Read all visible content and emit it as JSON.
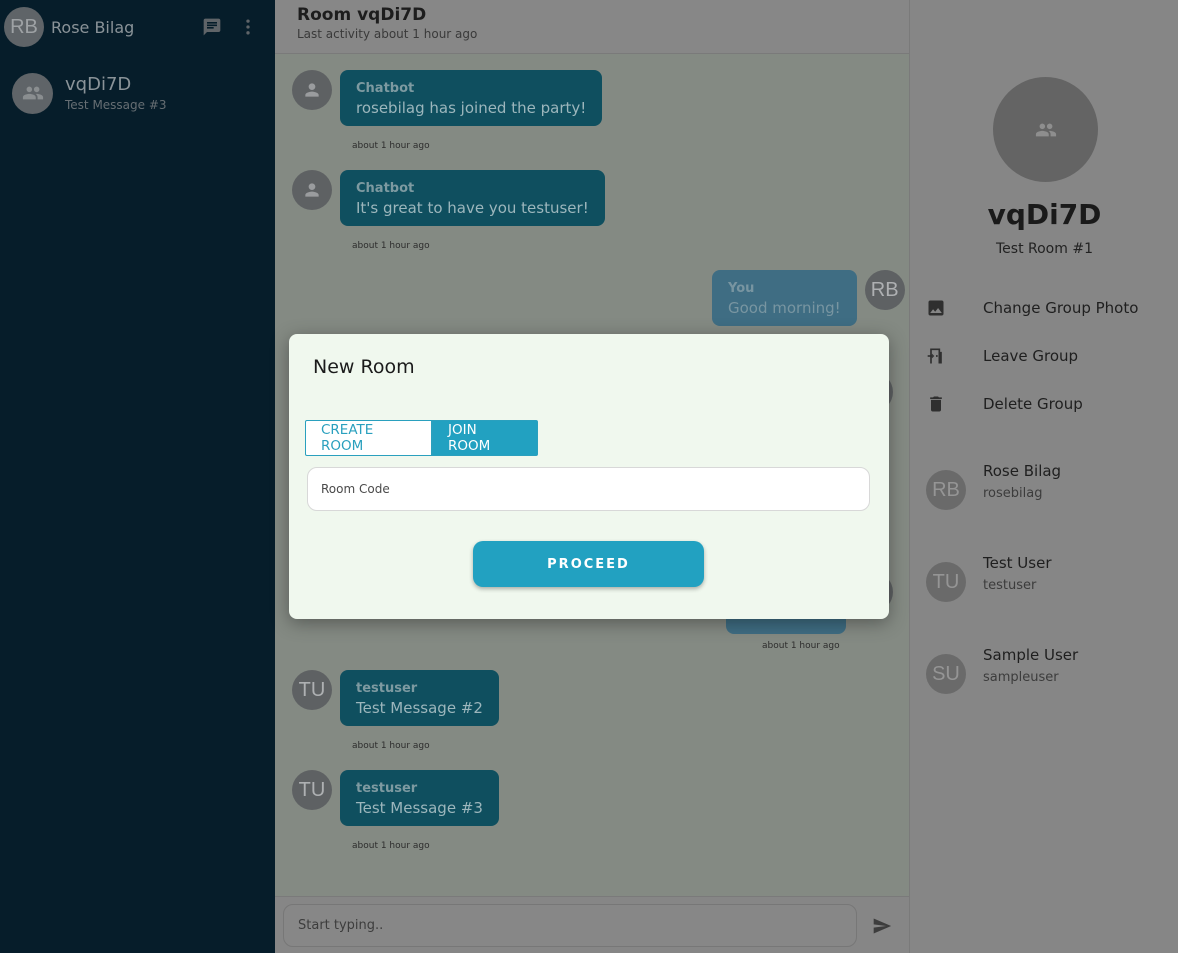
{
  "user": {
    "initials": "RB",
    "name": "Rose Bilag"
  },
  "sidebar": {
    "rooms": [
      {
        "name": "vqDi7D",
        "last_message": "Test Message #3"
      }
    ]
  },
  "chat": {
    "title": "Room vqDi7D",
    "subtitle": "Last activity about 1 hour ago",
    "messages": [
      {
        "sender": "Chatbot",
        "text": "rosebilag has joined the party!",
        "time": "about 1 hour ago",
        "initials": "",
        "mine": false
      },
      {
        "sender": "Chatbot",
        "text": "It's great to have you testuser!",
        "time": "about 1 hour ago",
        "initials": "",
        "mine": false
      },
      {
        "sender": "You",
        "text": "Good morning!",
        "time": "",
        "initials": "RB",
        "mine": true
      },
      {
        "sender": "",
        "text": "",
        "time": "about 1 hour ago",
        "initials": "",
        "mine": true
      },
      {
        "sender": "testuser",
        "text": "Test Message #2",
        "time": "about 1 hour ago",
        "initials": "TU",
        "mine": false
      },
      {
        "sender": "testuser",
        "text": "Test Message #3",
        "time": "about 1 hour ago",
        "initials": "TU",
        "mine": false
      }
    ],
    "composer_placeholder": "Start typing.."
  },
  "panel": {
    "group_name": "vqDi7D",
    "group_description": "Test Room #1",
    "actions": [
      {
        "label": "Change Group Photo",
        "icon": "image-icon"
      },
      {
        "label": "Leave Group",
        "icon": "door-exit-icon"
      },
      {
        "label": "Delete Group",
        "icon": "trash-icon"
      }
    ],
    "members": [
      {
        "initials": "RB",
        "name": "Rose Bilag",
        "username": "rosebilag"
      },
      {
        "initials": "TU",
        "name": "Test User",
        "username": "testuser"
      },
      {
        "initials": "SU",
        "name": "Sample User",
        "username": "sampleuser"
      }
    ]
  },
  "modal": {
    "title": "New Room",
    "tabs": [
      {
        "label": "CREATE ROOM",
        "active": false
      },
      {
        "label": "JOIN ROOM",
        "active": true
      }
    ],
    "input_placeholder": "Room Code",
    "submit_label": "PROCEED"
  },
  "colors": {
    "accent": "#22a1c1",
    "sidebar_bg": "#061d2a",
    "bubble": "#0f4f5f",
    "modal_bg": "#f0f8ee"
  }
}
